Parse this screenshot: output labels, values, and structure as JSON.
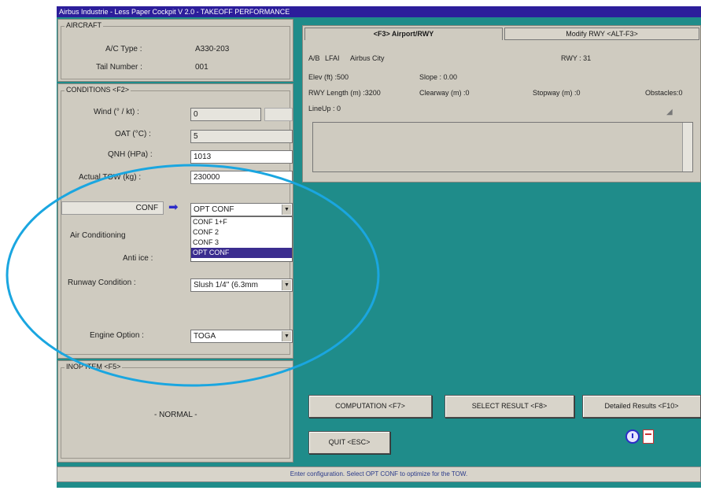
{
  "window": {
    "title": "Airbus Industrie - Less Paper Cockpit V 2.0 - TAKEOFF PERFORMANCE"
  },
  "aircraft": {
    "title": "AIRCRAFT",
    "ac_type_label": "A/C Type :",
    "ac_type_value": "A330-203",
    "tail_label": "Tail Number :",
    "tail_value": "001"
  },
  "conditions": {
    "title": "CONDITIONS <F2>",
    "wind_label": "Wind (° / kt) :",
    "wind_value": "0",
    "oat_label": "OAT (°C) :",
    "oat_value": "5",
    "qnh_label": "QNH (HPa) :",
    "qnh_value": "1013",
    "tow_label": "Actual TOW (kg) :",
    "tow_value": "230000",
    "conf_label": "CONF",
    "conf_value": "OPT CONF",
    "conf_options": [
      "CONF 1+F",
      "CONF 2",
      "CONF 3",
      "OPT CONF"
    ],
    "aircon_label": "Air Conditioning",
    "antiice_label": "Anti ice :",
    "runway_cond_label": "Runway Condition :",
    "runway_cond_value": "Slush 1/4\" (6.3mm",
    "engine_label": "Engine Option :",
    "engine_value": "TOGA"
  },
  "inop": {
    "title": "INOP ITEM <F5>",
    "value": "- NORMAL -"
  },
  "airport": {
    "tab_active": "<F3> Airport/RWY",
    "tab_modify": "Modify RWY <ALT-F3>",
    "ais_label": "A/B",
    "icao": "LFAI",
    "name": "Airbus City",
    "rwy": "RWY : 31",
    "elev": "Elev (ft) :500",
    "slope": "Slope : 0.00",
    "rwy_length": "RWY Length (m) :3200",
    "clearway": "Clearway (m) :0",
    "stopway": "Stopway (m) :0",
    "obstacles": "Obstacles:0",
    "lineup": "LineUp : 0"
  },
  "buttons": {
    "computation": "COMPUTATION <F7>",
    "select_result": "SELECT RESULT <F8>",
    "detailed": "Detailed Results <F10>",
    "quit": "QUIT <ESC>"
  },
  "status": "Enter configuration. Select OPT CONF to optimize for the TOW.",
  "colors": {
    "background": "#1f8c8a",
    "titlebar": "#2c1e9b",
    "annotation": "#1aa6e0",
    "selection": "#3b2d8f"
  }
}
